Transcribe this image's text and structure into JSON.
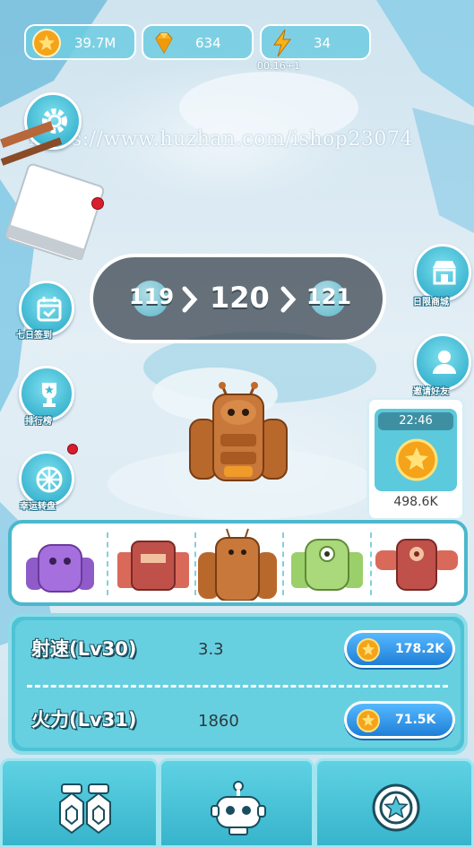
{
  "resources": {
    "coins": "39.7M",
    "gems": "634",
    "energy": "34",
    "energy_timer": "00:16+1"
  },
  "watermark": "https://www.huzhan.com/ishop23074",
  "side_left": [
    {
      "label": "",
      "icon": "gear-icon"
    },
    {
      "label": "七日签到",
      "icon": "calendar-icon"
    },
    {
      "label": "排行榜",
      "icon": "trophy-icon"
    },
    {
      "label": "幸运转盘",
      "icon": "wheel-icon"
    }
  ],
  "side_right": [
    {
      "label": "日限商城",
      "icon": "shop-icon"
    },
    {
      "label": "邀请好友",
      "icon": "user-icon"
    }
  ],
  "level": {
    "prev": "119",
    "current": "120",
    "next": "121"
  },
  "reward": {
    "timer": "22:46",
    "value": "498.6K"
  },
  "carousel": [
    "purple-robot",
    "red-robot",
    "orange-robot",
    "green-robot",
    "red-tank-robot"
  ],
  "upgrades": [
    {
      "label": "射速(Lv30)",
      "value": "3.3",
      "price": "178.2K"
    },
    {
      "label": "火力(Lv31)",
      "value": "1860",
      "price": "71.5K"
    }
  ],
  "colors": {
    "accent": "#4fc3d6",
    "button": "#1f7fd8",
    "coin": "#f5a31a"
  }
}
